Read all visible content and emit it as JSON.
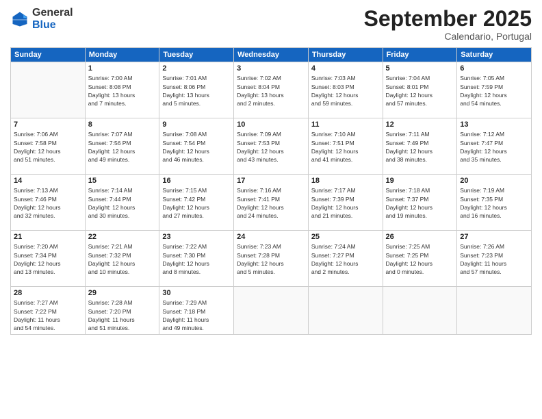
{
  "logo": {
    "general": "General",
    "blue": "Blue"
  },
  "title": "September 2025",
  "subtitle": "Calendario, Portugal",
  "days_header": [
    "Sunday",
    "Monday",
    "Tuesday",
    "Wednesday",
    "Thursday",
    "Friday",
    "Saturday"
  ],
  "weeks": [
    [
      {
        "num": "",
        "info": ""
      },
      {
        "num": "1",
        "info": "Sunrise: 7:00 AM\nSunset: 8:08 PM\nDaylight: 13 hours\nand 7 minutes."
      },
      {
        "num": "2",
        "info": "Sunrise: 7:01 AM\nSunset: 8:06 PM\nDaylight: 13 hours\nand 5 minutes."
      },
      {
        "num": "3",
        "info": "Sunrise: 7:02 AM\nSunset: 8:04 PM\nDaylight: 13 hours\nand 2 minutes."
      },
      {
        "num": "4",
        "info": "Sunrise: 7:03 AM\nSunset: 8:03 PM\nDaylight: 12 hours\nand 59 minutes."
      },
      {
        "num": "5",
        "info": "Sunrise: 7:04 AM\nSunset: 8:01 PM\nDaylight: 12 hours\nand 57 minutes."
      },
      {
        "num": "6",
        "info": "Sunrise: 7:05 AM\nSunset: 7:59 PM\nDaylight: 12 hours\nand 54 minutes."
      }
    ],
    [
      {
        "num": "7",
        "info": "Sunrise: 7:06 AM\nSunset: 7:58 PM\nDaylight: 12 hours\nand 51 minutes."
      },
      {
        "num": "8",
        "info": "Sunrise: 7:07 AM\nSunset: 7:56 PM\nDaylight: 12 hours\nand 49 minutes."
      },
      {
        "num": "9",
        "info": "Sunrise: 7:08 AM\nSunset: 7:54 PM\nDaylight: 12 hours\nand 46 minutes."
      },
      {
        "num": "10",
        "info": "Sunrise: 7:09 AM\nSunset: 7:53 PM\nDaylight: 12 hours\nand 43 minutes."
      },
      {
        "num": "11",
        "info": "Sunrise: 7:10 AM\nSunset: 7:51 PM\nDaylight: 12 hours\nand 41 minutes."
      },
      {
        "num": "12",
        "info": "Sunrise: 7:11 AM\nSunset: 7:49 PM\nDaylight: 12 hours\nand 38 minutes."
      },
      {
        "num": "13",
        "info": "Sunrise: 7:12 AM\nSunset: 7:47 PM\nDaylight: 12 hours\nand 35 minutes."
      }
    ],
    [
      {
        "num": "14",
        "info": "Sunrise: 7:13 AM\nSunset: 7:46 PM\nDaylight: 12 hours\nand 32 minutes."
      },
      {
        "num": "15",
        "info": "Sunrise: 7:14 AM\nSunset: 7:44 PM\nDaylight: 12 hours\nand 30 minutes."
      },
      {
        "num": "16",
        "info": "Sunrise: 7:15 AM\nSunset: 7:42 PM\nDaylight: 12 hours\nand 27 minutes."
      },
      {
        "num": "17",
        "info": "Sunrise: 7:16 AM\nSunset: 7:41 PM\nDaylight: 12 hours\nand 24 minutes."
      },
      {
        "num": "18",
        "info": "Sunrise: 7:17 AM\nSunset: 7:39 PM\nDaylight: 12 hours\nand 21 minutes."
      },
      {
        "num": "19",
        "info": "Sunrise: 7:18 AM\nSunset: 7:37 PM\nDaylight: 12 hours\nand 19 minutes."
      },
      {
        "num": "20",
        "info": "Sunrise: 7:19 AM\nSunset: 7:35 PM\nDaylight: 12 hours\nand 16 minutes."
      }
    ],
    [
      {
        "num": "21",
        "info": "Sunrise: 7:20 AM\nSunset: 7:34 PM\nDaylight: 12 hours\nand 13 minutes."
      },
      {
        "num": "22",
        "info": "Sunrise: 7:21 AM\nSunset: 7:32 PM\nDaylight: 12 hours\nand 10 minutes."
      },
      {
        "num": "23",
        "info": "Sunrise: 7:22 AM\nSunset: 7:30 PM\nDaylight: 12 hours\nand 8 minutes."
      },
      {
        "num": "24",
        "info": "Sunrise: 7:23 AM\nSunset: 7:28 PM\nDaylight: 12 hours\nand 5 minutes."
      },
      {
        "num": "25",
        "info": "Sunrise: 7:24 AM\nSunset: 7:27 PM\nDaylight: 12 hours\nand 2 minutes."
      },
      {
        "num": "26",
        "info": "Sunrise: 7:25 AM\nSunset: 7:25 PM\nDaylight: 12 hours\nand 0 minutes."
      },
      {
        "num": "27",
        "info": "Sunrise: 7:26 AM\nSunset: 7:23 PM\nDaylight: 11 hours\nand 57 minutes."
      }
    ],
    [
      {
        "num": "28",
        "info": "Sunrise: 7:27 AM\nSunset: 7:22 PM\nDaylight: 11 hours\nand 54 minutes."
      },
      {
        "num": "29",
        "info": "Sunrise: 7:28 AM\nSunset: 7:20 PM\nDaylight: 11 hours\nand 51 minutes."
      },
      {
        "num": "30",
        "info": "Sunrise: 7:29 AM\nSunset: 7:18 PM\nDaylight: 11 hours\nand 49 minutes."
      },
      {
        "num": "",
        "info": ""
      },
      {
        "num": "",
        "info": ""
      },
      {
        "num": "",
        "info": ""
      },
      {
        "num": "",
        "info": ""
      }
    ]
  ]
}
